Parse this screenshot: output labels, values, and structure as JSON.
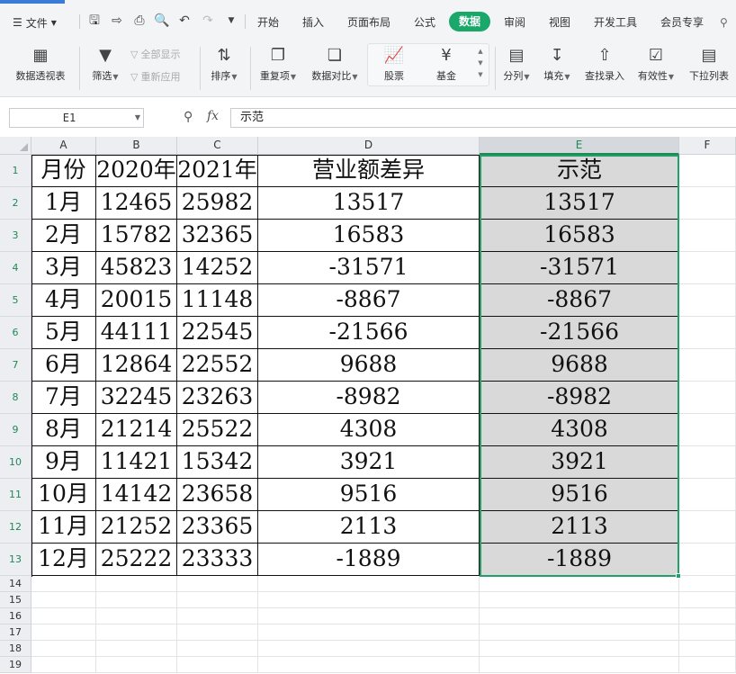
{
  "menu": {
    "file_label": "文件",
    "tabs": [
      "开始",
      "插入",
      "页面布局",
      "公式",
      "数据",
      "审阅",
      "视图",
      "开发工具",
      "会员专享"
    ],
    "active_tab": "数据",
    "search_icon": "search-icon"
  },
  "quick_access_icons": [
    "save-icon",
    "export-icon",
    "print-icon",
    "print-preview-icon",
    "undo-icon",
    "redo-icon",
    "more-icon"
  ],
  "ribbon": {
    "pivot": "数据透视表",
    "filter": "筛选",
    "show_all": "全部显示",
    "reapply": "重新应用",
    "sort": "排序",
    "duplicates": "重复项",
    "compare": "数据对比",
    "stock": "股票",
    "fund": "基金",
    "split": "分列",
    "fill": "填充",
    "lookup": "查找录入",
    "validity": "有效性",
    "dropdown_list": "下拉列表"
  },
  "formula_bar": {
    "name_box": "E1",
    "fx": "fx",
    "content": "示范"
  },
  "sheet": {
    "columns": [
      "A",
      "B",
      "C",
      "D",
      "E",
      "F"
    ],
    "selected_column": "E",
    "row_numbers": [
      "1",
      "2",
      "3",
      "4",
      "5",
      "6",
      "7",
      "8",
      "9",
      "10",
      "11",
      "12",
      "13",
      "14",
      "15",
      "16",
      "17",
      "18",
      "19"
    ],
    "rows": [
      [
        "月份",
        "2020年",
        "2021年",
        "营业额差异",
        "示范"
      ],
      [
        "1月",
        "12465",
        "25982",
        "13517",
        "13517"
      ],
      [
        "2月",
        "15782",
        "32365",
        "16583",
        "16583"
      ],
      [
        "3月",
        "45823",
        "14252",
        "-31571",
        "-31571"
      ],
      [
        "4月",
        "20015",
        "11148",
        "-8867",
        "-8867"
      ],
      [
        "5月",
        "44111",
        "22545",
        "-21566",
        "-21566"
      ],
      [
        "6月",
        "12864",
        "22552",
        "9688",
        "9688"
      ],
      [
        "7月",
        "32245",
        "23263",
        "-8982",
        "-8982"
      ],
      [
        "8月",
        "21214",
        "25522",
        "4308",
        "4308"
      ],
      [
        "9月",
        "11421",
        "15342",
        "3921",
        "3921"
      ],
      [
        "10月",
        "14142",
        "23658",
        "9516",
        "9516"
      ],
      [
        "11月",
        "21252",
        "23365",
        "2113",
        "2113"
      ],
      [
        "12月",
        "25222",
        "23333",
        "-1889",
        "-1889"
      ]
    ]
  },
  "colors": {
    "accent": "#1aa86a",
    "selection_border": "#22a06b",
    "selection_fill": "#d9d9d9"
  }
}
